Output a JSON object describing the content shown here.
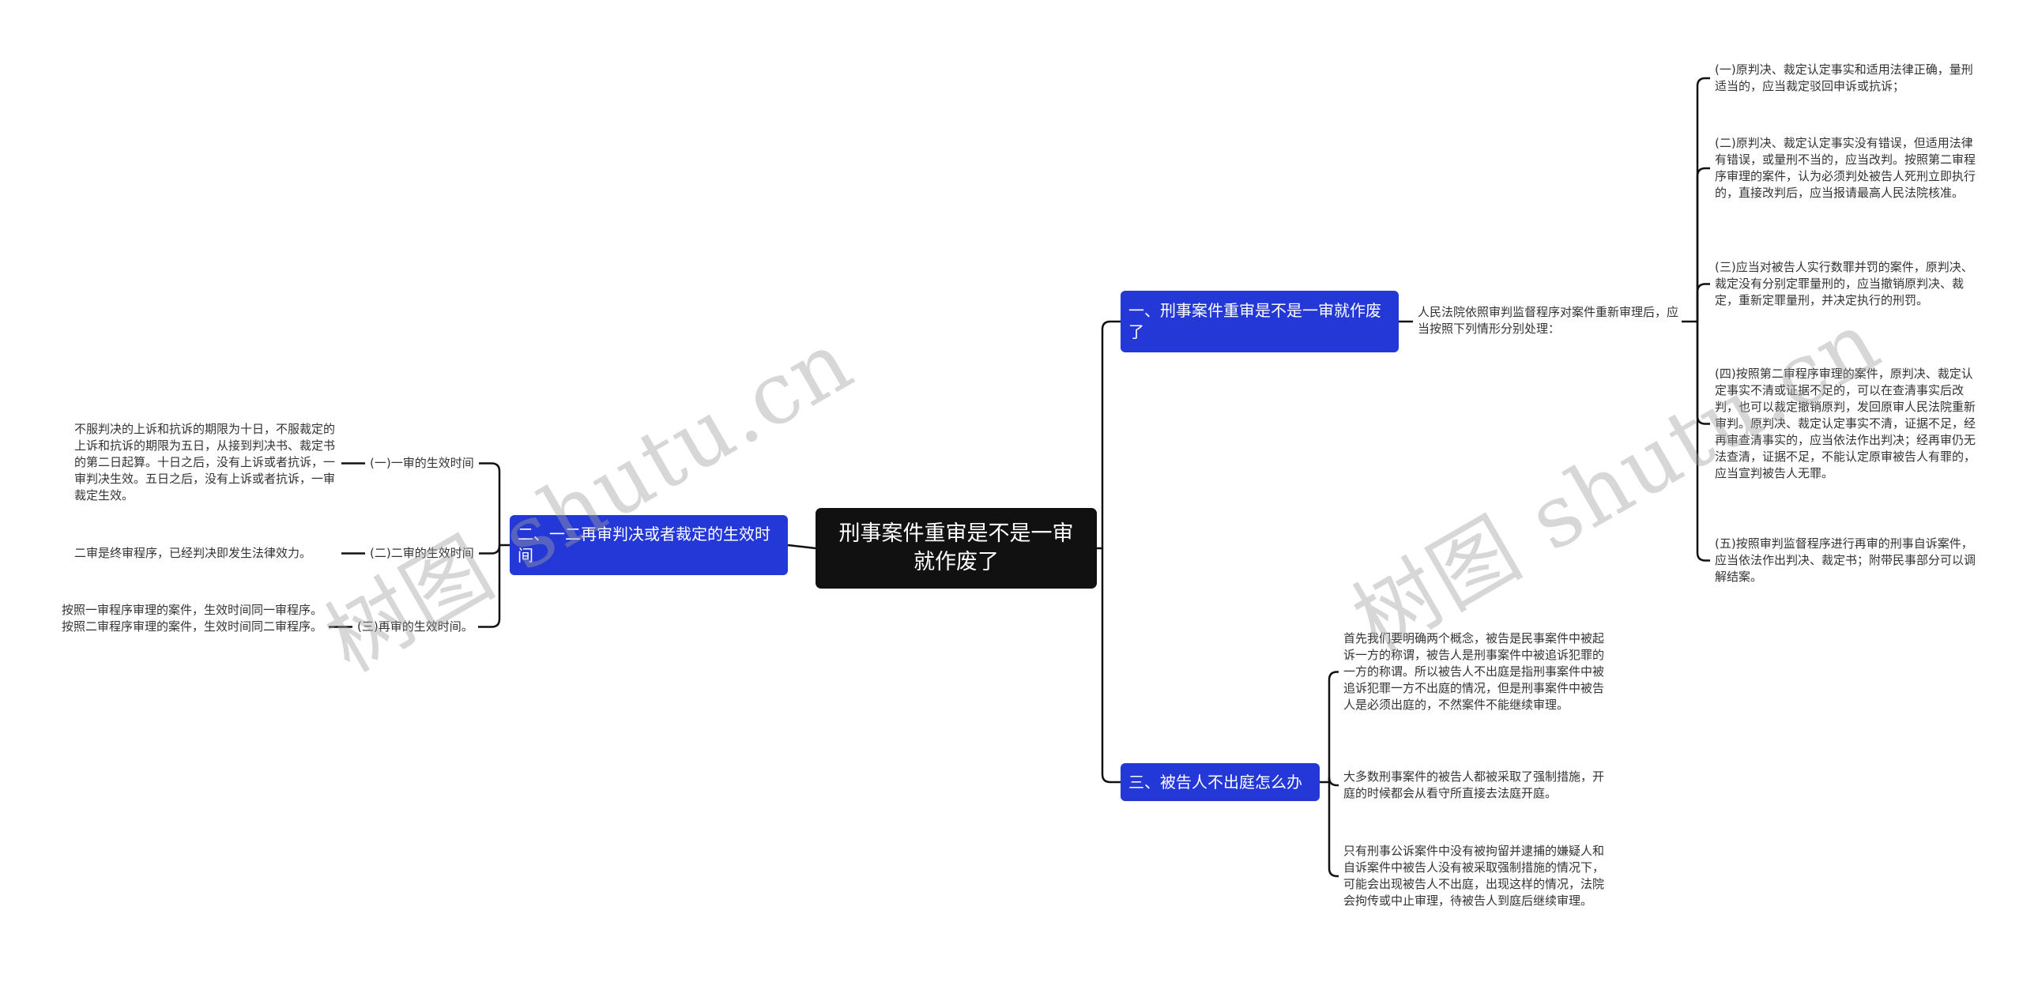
{
  "root": {
    "title": "刑事案件重审是不是一审就作废了"
  },
  "branches": [
    {
      "label": "一、刑事案件重审是不是一审就作废了",
      "intro": "人民法院依照审判监督程序对案件重新审理后，应当按照下列情形分别处理：",
      "children": [
        "(一)原判决、裁定认定事实和适用法律正确，量刑适当的，应当裁定驳回申诉或抗诉；",
        "(二)原判决、裁定认定事实没有错误，但适用法律有错误，或量刑不当的，应当改判。按照第二审程序审理的案件，认为必须判处被告人死刑立即执行的，直接改判后，应当报请最高人民法院核准。",
        "(三)应当对被告人实行数罪并罚的案件，原判决、裁定没有分别定罪量刑的，应当撤销原判决、裁定，重新定罪量刑，并决定执行的刑罚。",
        "(四)按照第二审程序审理的案件，原判决、裁定认定事实不清或证据不足的，可以在查清事实后改判，也可以裁定撤销原判，发回原审人民法院重新审判。原判决、裁定认定事实不清，证据不足，经再审查清事实的，应当依法作出判决；经再审仍无法查清，证据不足，不能认定原审被告人有罪的，应当宣判被告人无罪。",
        "(五)按照审判监督程序进行再审的刑事自诉案件，应当依法作出判决、裁定书；附带民事部分可以调解结案。"
      ]
    },
    {
      "label": "二、一二再审判决或者裁定的生效时间",
      "children": [
        {
          "label": "(一)一审的生效时间",
          "detail": "不服判决的上诉和抗诉的期限为十日，不服裁定的上诉和抗诉的期限为五日，从接到判决书、裁定书的第二日起算。十日之后，没有上诉或者抗诉，一审判决生效。五日之后，没有上诉或者抗诉，一审裁定生效。"
        },
        {
          "label": "(二)二审的生效时间",
          "detail": "二审是终审程序，已经判决即发生法律效力。"
        },
        {
          "label": "(三)再审的生效时间。",
          "detail": "按照一审程序审理的案件，生效时间同一审程序。按照二审程序审理的案件，生效时间同二审程序。"
        }
      ]
    },
    {
      "label": "三、被告人不出庭怎么办",
      "children": [
        "首先我们要明确两个概念，被告是民事案件中被起诉一方的称谓，被告人是刑事案件中被追诉犯罪的一方的称谓。所以被告人不出庭是指刑事案件中被追诉犯罪一方不出庭的情况，但是刑事案件中被告人是必须出庭的，不然案件不能继续审理。",
        "大多数刑事案件的被告人都被采取了强制措施，开庭的时候都会从看守所直接去法庭开庭。",
        "只有刑事公诉案件中没有被拘留并逮捕的嫌疑人和自诉案件中被告人没有被采取强制措施的情况下，可能会出现被告人不出庭，出现这样的情况，法院会拘传或中止审理，待被告人到庭后继续审理。"
      ]
    }
  ],
  "watermarks": [
    "树图 shutu.cn",
    "树图 shutu.cn"
  ],
  "colors": {
    "root_bg": "#111111",
    "branch_bg": "#2338d6",
    "line": "#111111",
    "watermark": "#a0a0a0"
  }
}
